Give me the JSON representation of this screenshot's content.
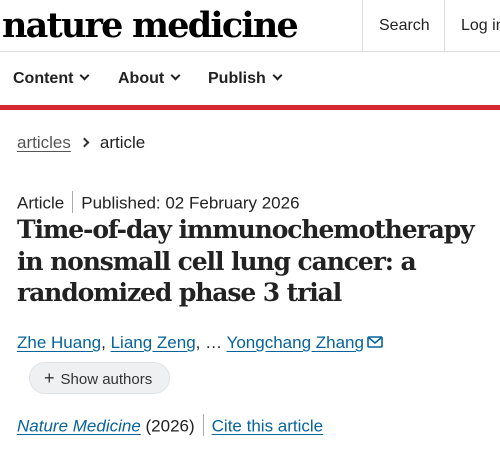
{
  "header": {
    "logo": "nature medicine",
    "search_label": "Search",
    "login_label": "Log in"
  },
  "nav": {
    "items": [
      {
        "label": "Content"
      },
      {
        "label": "About"
      },
      {
        "label": "Publish"
      }
    ]
  },
  "colors": {
    "brand_red": "#d5272f",
    "link_blue": "#06639c"
  },
  "breadcrumb": {
    "items": [
      "articles",
      "article"
    ]
  },
  "article": {
    "type": "Article",
    "published": "Published: 02 February 2026",
    "title": "Time-of-day immunochemotherapy in nonsmall cell lung cancer: a randomized phase 3 trial",
    "authors": [
      "Zhe Huang",
      "Liang Zeng",
      "Yongchang Zhang"
    ],
    "author_sep": ",",
    "ellipsis": "…",
    "show_authors_label": "Show authors",
    "journal": "Nature Medicine",
    "year": "(2026)",
    "cite_label": "Cite this article"
  }
}
